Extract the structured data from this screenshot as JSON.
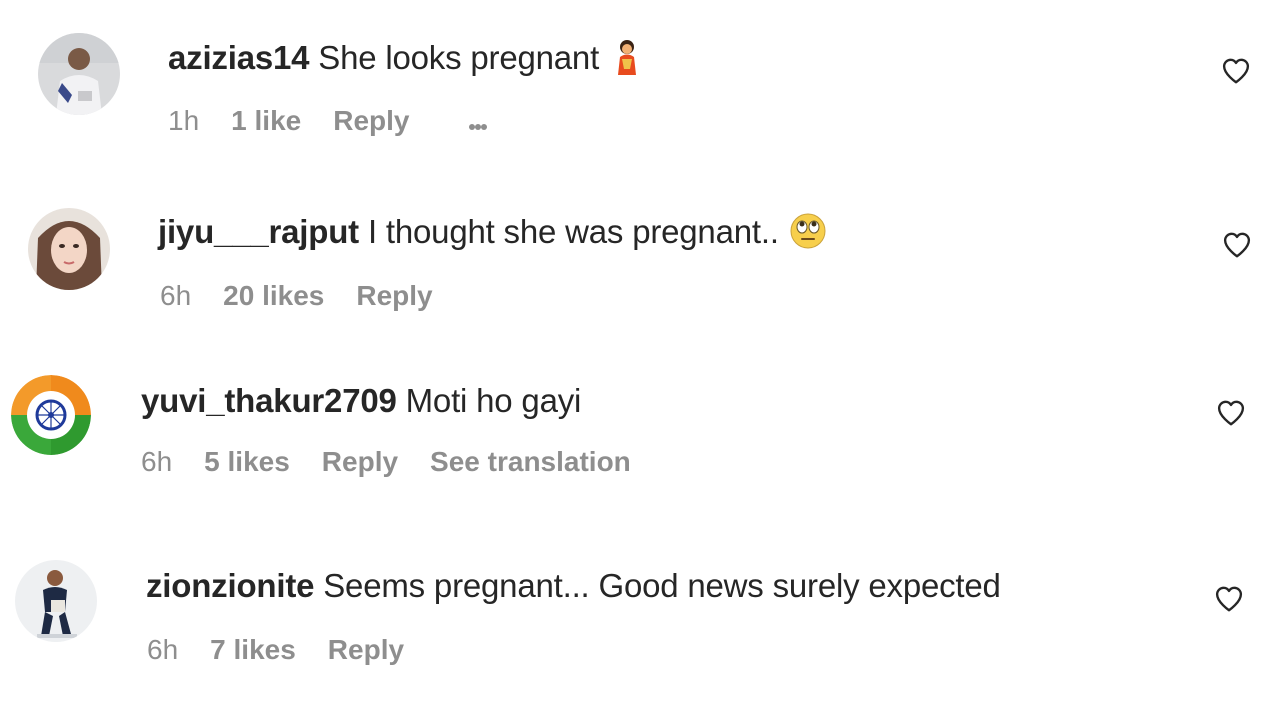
{
  "comments": [
    {
      "username": "azizias14",
      "text": "She looks pregnant",
      "emoji": "woman-emoji",
      "time": "1h",
      "likes": "1 like",
      "reply": "Reply",
      "extra": ""
    },
    {
      "username": "jiyu___rajput",
      "text": "I thought she was pregnant..",
      "emoji": "face-with-rolling-eyes-emoji",
      "time": "6h",
      "likes": "20 likes",
      "reply": "Reply",
      "extra": ""
    },
    {
      "username": "yuvi_thakur2709",
      "text": "Moti ho gayi",
      "emoji": "",
      "time": "6h",
      "likes": "5 likes",
      "reply": "Reply",
      "extra": "See translation"
    },
    {
      "username": "zionzionite",
      "text": "Seems pregnant... Good news surely expected",
      "emoji": "",
      "time": "6h",
      "likes": "7 likes",
      "reply": "Reply",
      "extra": ""
    }
  ],
  "icons": {
    "like": "heart-outline-icon",
    "more": "more-options-icon"
  },
  "colors": {
    "text": "#262626",
    "secondary": "#8e8e8e",
    "background": "#ffffff"
  }
}
